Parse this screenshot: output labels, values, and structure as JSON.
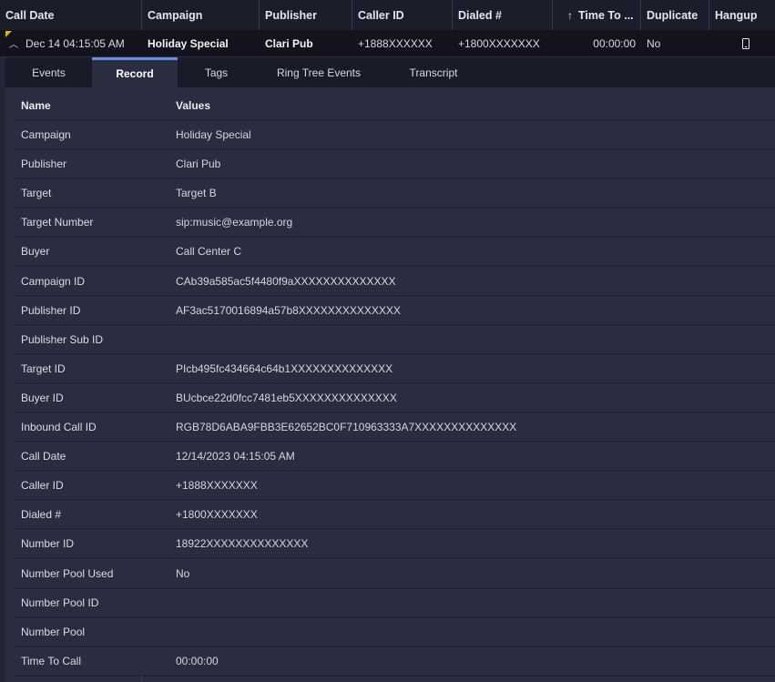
{
  "header": {
    "columns": [
      {
        "label": "Call Date",
        "width": 156
      },
      {
        "label": "Campaign",
        "width": 129
      },
      {
        "label": "Publisher",
        "width": 102
      },
      {
        "label": "Caller ID",
        "width": 110
      },
      {
        "label": "Dialed #",
        "width": 110
      },
      {
        "label": "Time To ...",
        "width": 97
      },
      {
        "label": "Duplicate",
        "width": 75
      },
      {
        "label": "Hangup",
        "width": 72
      }
    ]
  },
  "row": {
    "call_date": "Dec 14 04:15:05 AM",
    "campaign": "Holiday Special",
    "publisher": "Clari Pub",
    "caller_id": "+1888XXXXXX",
    "dialed": "+1800XXXXXXX",
    "time_to_call": "00:00:00",
    "duplicate": "No"
  },
  "tabs": [
    {
      "label": "Events",
      "width": 95
    },
    {
      "label": "Record",
      "width": 94
    },
    {
      "label": "Tags",
      "width": 85
    },
    {
      "label": "Ring Tree Events",
      "width": 140
    },
    {
      "label": "Transcript",
      "width": 112
    }
  ],
  "record": {
    "header_name": "Name",
    "header_values": "Values",
    "rows": [
      {
        "name": "Campaign",
        "value": "Holiday Special"
      },
      {
        "name": "Publisher",
        "value": "Clari Pub"
      },
      {
        "name": "Target",
        "value": "Target B"
      },
      {
        "name": "Target Number",
        "value": "sip:music@example.org"
      },
      {
        "name": "Buyer",
        "value": "Call Center C"
      },
      {
        "name": "Campaign ID",
        "value": "CAb39a585ac5f4480f9aXXXXXXXXXXXXXX"
      },
      {
        "name": "Publisher ID",
        "value": "AF3ac5170016894a57b8XXXXXXXXXXXXXX"
      },
      {
        "name": "Publisher Sub ID",
        "value": ""
      },
      {
        "name": "Target ID",
        "value": "PIcb495fc434664c64b1XXXXXXXXXXXXXX"
      },
      {
        "name": "Buyer ID",
        "value": "BUcbce22d0fcc7481eb5XXXXXXXXXXXXXX"
      },
      {
        "name": "Inbound Call ID",
        "value": "RGB78D6ABA9FBB3E62652BC0F710963333A7XXXXXXXXXXXXXX"
      },
      {
        "name": "Call Date",
        "value": "12/14/2023 04:15:05 AM"
      },
      {
        "name": "Caller ID",
        "value": "+1888XXXXXXX"
      },
      {
        "name": "Dialed #",
        "value": "+1800XXXXXXX"
      },
      {
        "name": "Number ID",
        "value": "18922XXXXXXXXXXXXXX"
      },
      {
        "name": "Number Pool Used",
        "value": "No"
      },
      {
        "name": "Number Pool ID",
        "value": ""
      },
      {
        "name": "Number Pool",
        "value": ""
      },
      {
        "name": "Time To Call",
        "value": "00:00:00"
      }
    ]
  }
}
